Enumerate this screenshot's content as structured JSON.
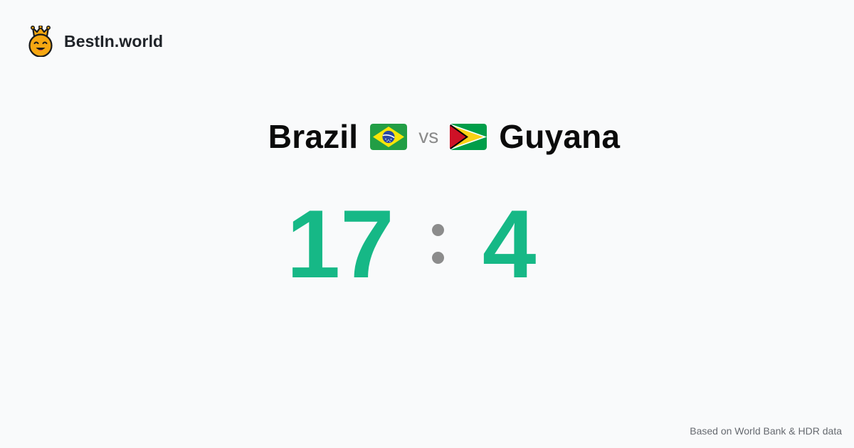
{
  "brand": {
    "name": "BestIn.world",
    "logo_icon": "crowned-smiley-icon"
  },
  "matchup": {
    "left_country": "Brazil",
    "left_flag_icon": "brazil-flag-icon",
    "vs_label": "vs",
    "right_country": "Guyana",
    "right_flag_icon": "guyana-flag-icon"
  },
  "score": {
    "left_value": "17",
    "separator": ":",
    "right_value": "4"
  },
  "footer": {
    "source_note": "Based on World Bank & HDR data"
  },
  "colors": {
    "background": "#f9fafb",
    "score_green": "#16b886",
    "separator_gray": "#8c8c8c",
    "vs_gray": "#8a8a8a",
    "footer_gray": "#666a70"
  }
}
